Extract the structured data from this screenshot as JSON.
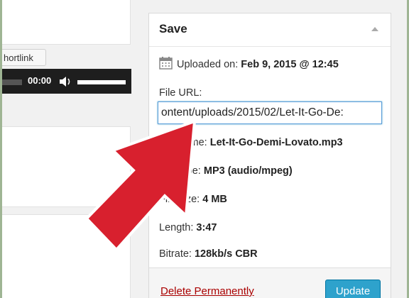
{
  "editor": {
    "shortlink_label": "hortlink",
    "player_time": "00:00"
  },
  "save_box": {
    "title": "Save",
    "uploaded_label": "Uploaded on:",
    "uploaded_value": "Feb 9, 2015 @ 12:45",
    "file_url_label": "File URL:",
    "file_url_value": ":ontent/uploads/2015/02/Let-It-Go-De",
    "file_name_label": "File name:",
    "file_name_value": "Let-It-Go-Demi-Lovato.mp3",
    "file_type_label": "File type:",
    "file_type_value": "MP3 (audio/mpeg)",
    "file_size_label": "File size:",
    "file_size_value": "4 MB",
    "length_label": "Length:",
    "length_value": "3:47",
    "bitrate_label": "Bitrate:",
    "bitrate_value": "128kb/s CBR",
    "delete_label": "Delete Permanently",
    "update_label": "Update"
  },
  "colors": {
    "arrow": "#d8202e",
    "update_button": "#2ea2cc",
    "delete_link": "#aa0000"
  },
  "icons": {
    "calendar": "calendar-icon",
    "volume": "volume-icon",
    "collapse": "collapse-arrow-icon"
  }
}
